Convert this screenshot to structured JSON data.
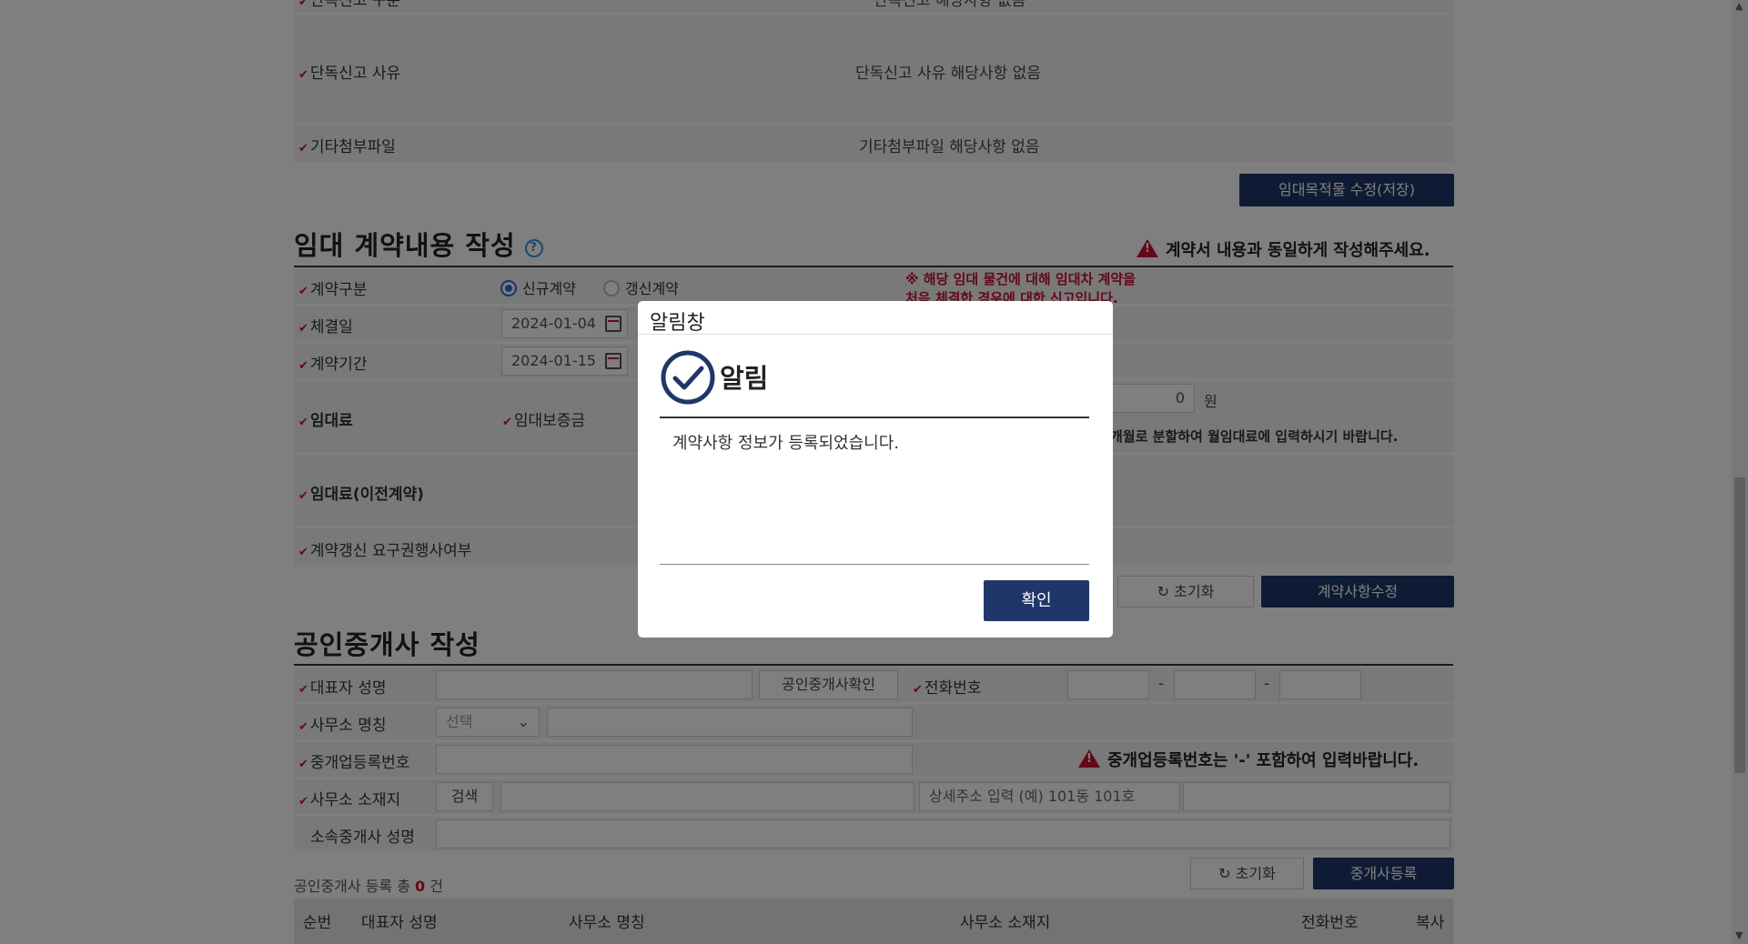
{
  "top_rows": {
    "row0_label": "단독신고 구분",
    "row0_value": "단독신고 해당사항 없음",
    "row1_label": "단독신고 사유",
    "row1_value": "단독신고 사유 해당사항 없음",
    "row2_label": "기타첨부파일",
    "row2_value": "기타첨부파일 해당사항 없음",
    "save_button": "임대목적물 수정(저장)"
  },
  "contract": {
    "title": "임대 계약내용 작성",
    "help_icon": "?",
    "warning": "계약서 내용과 동일하게 작성해주세요.",
    "note_line1": "※ 해당 임대 물건에 대해 임대차 계약을",
    "note_line2": "처음 체결한 경우에 대한 신고입니다.",
    "type_label": "계약구분",
    "radio_new": "신규계약",
    "radio_renew": "갱신계약",
    "date_label": "체결일",
    "date_value": "2024-01-04",
    "period_label": "계약기간",
    "period_value": "2024-01-15",
    "rent_label": "임대료",
    "deposit_label": "임대보증금",
    "amount_value": "0",
    "amount_unit": "원",
    "rent_hint": "개월로 분할하여 월임대료에 입력하시기 바랍니다.",
    "prev_rent_label": "임대료(이전계약)",
    "renewal_label": "계약갱신 요구권행사여부",
    "reset_button": "초기화",
    "edit_button": "계약사항수정"
  },
  "broker": {
    "title": "공인중개사 작성",
    "rep_label": "대표자 성명",
    "verify_button": "공인중개사확인",
    "phone_label": "전화번호",
    "dash1": "-",
    "dash2": "-",
    "office_label": "사무소 명칭",
    "office_select": "선택",
    "regno_label": "중개업등록번호",
    "regno_warning": "중개업등록번호는 '-' 포함하여 입력바랍니다.",
    "addr_label": "사무소 소재지",
    "search_button": "검색",
    "addr_placeholder": "상세주소 입력 (예) 101동 101호",
    "member_label": "소속중개사 성명",
    "reset_button": "초기화",
    "register_button": "중개사등록",
    "count_prefix": "공인중개사 등록 총",
    "count_value": "0",
    "count_suffix": "건",
    "table_headers": [
      "순번",
      "대표자 성명",
      "사무소 명칭",
      "사무소 소재지",
      "전화번호",
      "복사"
    ]
  },
  "modal": {
    "window_title": "알림창",
    "heading": "알림",
    "message": "계약사항 정보가 등록되었습니다.",
    "ok_button": "확인"
  }
}
